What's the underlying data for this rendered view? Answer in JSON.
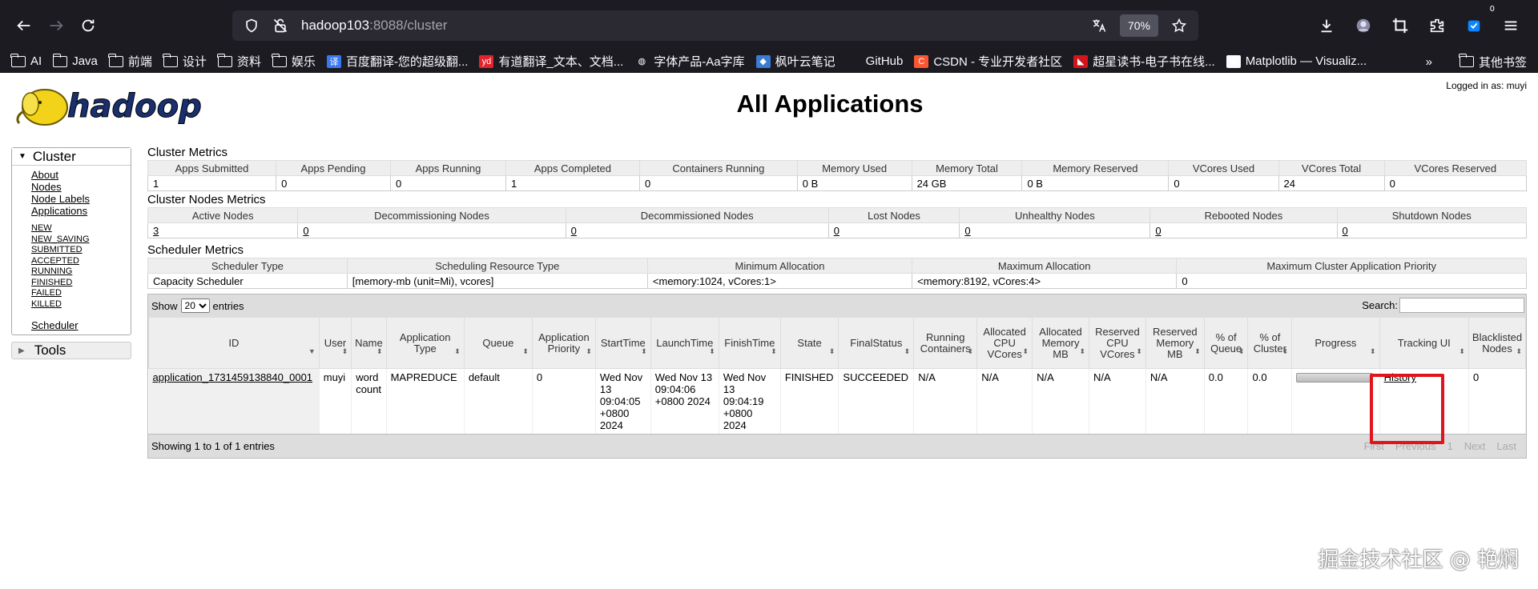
{
  "browser": {
    "url_host": "hadoop103",
    "url_path": ":8088/cluster",
    "zoom": "70%",
    "extension_badge": "0",
    "bookmarks": [
      {
        "label": "AI",
        "icon": "folder-icon"
      },
      {
        "label": "Java",
        "icon": "folder-icon"
      },
      {
        "label": "前端",
        "icon": "folder-icon"
      },
      {
        "label": "设计",
        "icon": "folder-icon"
      },
      {
        "label": "资料",
        "icon": "folder-icon"
      },
      {
        "label": "娱乐",
        "icon": "folder-icon"
      },
      {
        "label": "百度翻译-您的超级翻...",
        "icon": "baidu-translate-icon",
        "glyph": "译",
        "color": "#3a78f2"
      },
      {
        "label": "有道翻译_文本、文档...",
        "icon": "youdao-icon",
        "glyph": "yd",
        "color": "#e3232c"
      },
      {
        "label": "字体产品-Aa字库",
        "icon": "globe-icon",
        "glyph": "◍",
        "color": "transparent"
      },
      {
        "label": "枫叶云笔记",
        "icon": "fengye-note-icon",
        "glyph": "◆",
        "color": "#3a7bd5"
      },
      {
        "label": "GitHub",
        "icon": "github-icon",
        "glyph": "",
        "color": "transparent"
      },
      {
        "label": "CSDN - 专业开发者社区",
        "icon": "csdn-icon",
        "glyph": "C",
        "color": "#fc5531"
      },
      {
        "label": "超星读书-电子书在线...",
        "icon": "chaoxing-icon",
        "glyph": "◣",
        "color": "#d4141b"
      },
      {
        "label": "Matplotlib — Visualiz...",
        "icon": "matplotlib-icon",
        "glyph": "◉",
        "color": "#fbfbfe"
      }
    ],
    "other_bookmarks": "其他书签"
  },
  "page": {
    "title": "All Applications",
    "logged_in": "Logged in as: muyi",
    "logo_text": "hadoop"
  },
  "sidebar": {
    "cluster_label": "Cluster",
    "links": [
      "About",
      "Nodes",
      "Node Labels",
      "Applications"
    ],
    "app_states": [
      "NEW",
      "NEW_SAVING",
      "SUBMITTED",
      "ACCEPTED",
      "RUNNING",
      "FINISHED",
      "FAILED",
      "KILLED"
    ],
    "scheduler": "Scheduler",
    "tools_label": "Tools"
  },
  "cluster_metrics": {
    "title": "Cluster Metrics",
    "headers": [
      "Apps Submitted",
      "Apps Pending",
      "Apps Running",
      "Apps Completed",
      "Containers Running",
      "Memory Used",
      "Memory Total",
      "Memory Reserved",
      "VCores Used",
      "VCores Total",
      "VCores Reserved"
    ],
    "values": [
      "1",
      "0",
      "0",
      "1",
      "0",
      "0 B",
      "24 GB",
      "0 B",
      "0",
      "24",
      "0"
    ]
  },
  "node_metrics": {
    "title": "Cluster Nodes Metrics",
    "headers": [
      "Active Nodes",
      "Decommissioning Nodes",
      "Decommissioned Nodes",
      "Lost Nodes",
      "Unhealthy Nodes",
      "Rebooted Nodes",
      "Shutdown Nodes"
    ],
    "values": [
      "3",
      "0",
      "0",
      "0",
      "0",
      "0",
      "0"
    ]
  },
  "scheduler_metrics": {
    "title": "Scheduler Metrics",
    "headers": [
      "Scheduler Type",
      "Scheduling Resource Type",
      "Minimum Allocation",
      "Maximum Allocation",
      "Maximum Cluster Application Priority"
    ],
    "values": [
      "Capacity Scheduler",
      "[memory-mb (unit=Mi), vcores]",
      "<memory:1024, vCores:1>",
      "<memory:8192, vCores:4>",
      "0"
    ]
  },
  "apps_table": {
    "show_label": "Show",
    "page_size": "20",
    "entries_label": "entries",
    "search_label": "Search:",
    "search_value": "",
    "headers": [
      "ID",
      "User",
      "Name",
      "Application Type",
      "Queue",
      "Application Priority",
      "StartTime",
      "LaunchTime",
      "FinishTime",
      "State",
      "FinalStatus",
      "Running Containers",
      "Allocated CPU VCores",
      "Allocated Memory MB",
      "Reserved CPU VCores",
      "Reserved Memory MB",
      "% of Queue",
      "% of Cluster",
      "Progress",
      "Tracking UI",
      "Blacklisted Nodes"
    ],
    "row": {
      "id": "application_1731459138840_0001",
      "user": "muyi",
      "name": "word count",
      "type": "MAPREDUCE",
      "queue": "default",
      "priority": "0",
      "start": "Wed Nov 13 09:04:05 +0800 2024",
      "launch": "Wed Nov 13 09:04:06 +0800 2024",
      "finish": "Wed Nov 13 09:04:19 +0800 2024",
      "state": "FINISHED",
      "final_status": "SUCCEEDED",
      "running_containers": "N/A",
      "alloc_vcores": "N/A",
      "alloc_mem": "N/A",
      "res_vcores": "N/A",
      "res_mem": "N/A",
      "pct_queue": "0.0",
      "pct_cluster": "0.0",
      "progress": 1.0,
      "tracking_ui": "History",
      "blacklisted": "0"
    },
    "info": "Showing 1 to 1 of 1 entries",
    "pager": [
      "First",
      "Previous",
      "1",
      "Next",
      "Last"
    ]
  },
  "watermark": "掘金技术社区 @ 艳焖",
  "colors": {
    "highlight": "#e1141c",
    "chrome_bg": "#1c1b22",
    "urlbar_bg": "#2b2a33"
  }
}
